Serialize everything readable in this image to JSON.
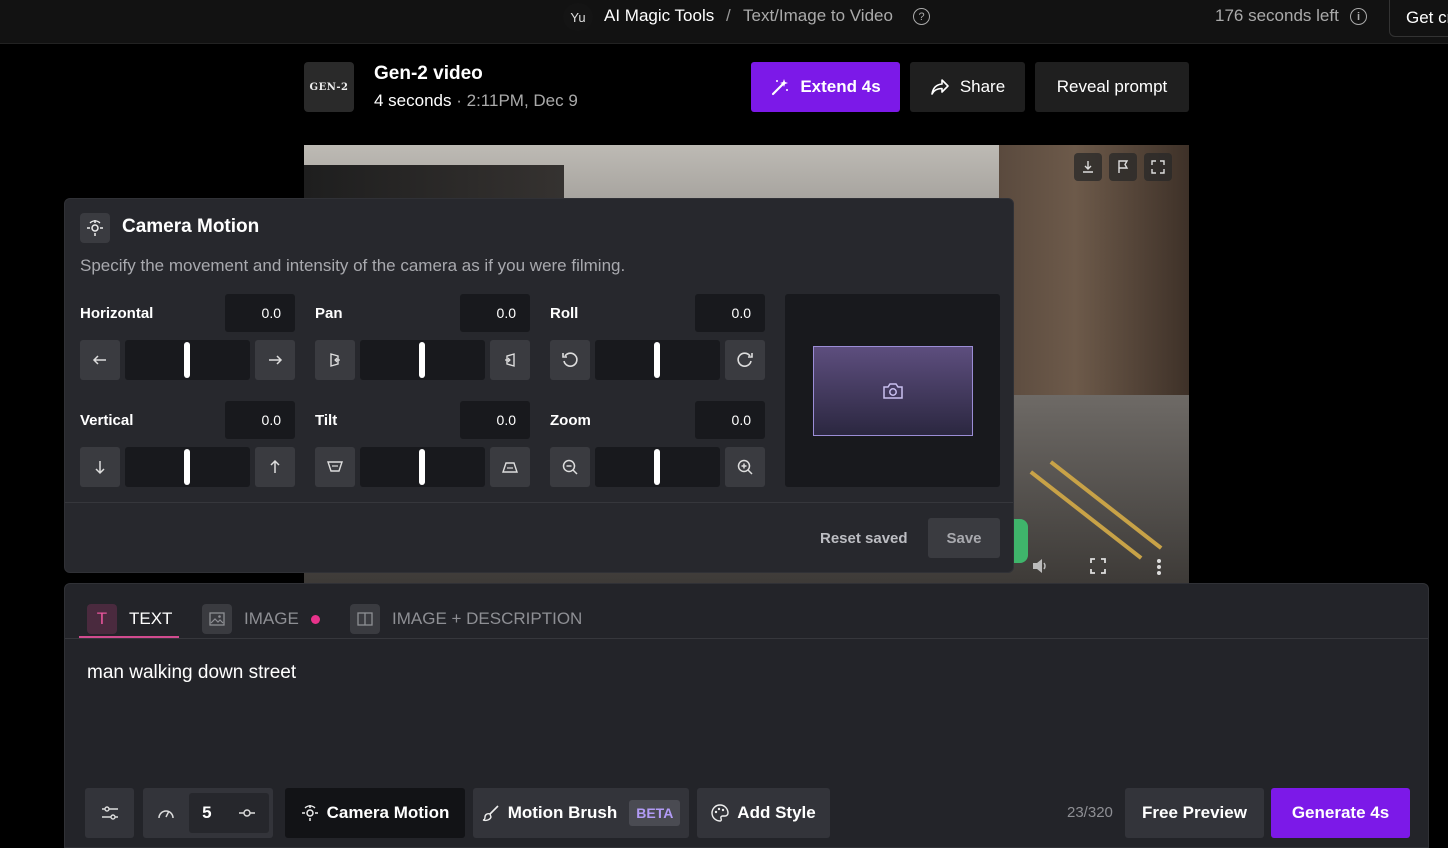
{
  "topbar": {
    "avatar_initials": "Yu",
    "breadcrumb_app": "AI Magic Tools",
    "breadcrumb_sep": "/",
    "breadcrumb_page": "Text/Image to Video",
    "help_glyph": "?",
    "seconds_left": "176 seconds left",
    "info_glyph": "i",
    "get_credits_label": "Get cr"
  },
  "header": {
    "logo_text": "GEN-2",
    "title": "Gen-2 video",
    "duration": "4 seconds",
    "timestamp": "· 2:11PM, Dec 9",
    "extend_label": "Extend 4s",
    "share_label": "Share",
    "reveal_label": "Reveal prompt"
  },
  "camera_motion": {
    "title": "Camera Motion",
    "description": "Specify the movement and intensity of the camera as if you were filming.",
    "controls": [
      {
        "label": "Horizontal",
        "value": "0.0",
        "left_icon": "arrow-left-icon",
        "right_icon": "arrow-right-icon",
        "level": 0.5
      },
      {
        "label": "Pan",
        "value": "0.0",
        "left_icon": "pan-left-icon",
        "right_icon": "pan-right-icon",
        "level": 0.5
      },
      {
        "label": "Roll",
        "value": "0.0",
        "left_icon": "rotate-ccw-icon",
        "right_icon": "rotate-cw-icon",
        "level": 0.5
      },
      {
        "label": "Vertical",
        "value": "0.0",
        "left_icon": "arrow-down-icon",
        "right_icon": "arrow-up-icon",
        "level": 0.5
      },
      {
        "label": "Tilt",
        "value": "0.0",
        "left_icon": "tilt-down-icon",
        "right_icon": "tilt-up-icon",
        "level": 0.5
      },
      {
        "label": "Zoom",
        "value": "0.0",
        "left_icon": "zoom-out-icon",
        "right_icon": "zoom-in-icon",
        "level": 0.5
      }
    ],
    "reset_label": "Reset saved",
    "save_label": "Save"
  },
  "prompt_panel": {
    "tabs": [
      {
        "label": "TEXT",
        "icon_glyph": "T",
        "active": true
      },
      {
        "label": "IMAGE",
        "active": false
      },
      {
        "label": "IMAGE + DESCRIPTION",
        "active": false
      }
    ],
    "prompt_text": "man walking down street",
    "seed_value": "5",
    "camera_motion_label": "Camera Motion",
    "motion_brush_label": "Motion Brush",
    "beta_label": "BETA",
    "add_style_label": "Add Style",
    "char_count": "23/320",
    "free_preview_label": "Free Preview",
    "generate_label": "Generate 4s"
  },
  "colors": {
    "accent_purple": "#7c19e8",
    "tab_pink": "#d14b8f",
    "panel_bg": "#27282d"
  }
}
